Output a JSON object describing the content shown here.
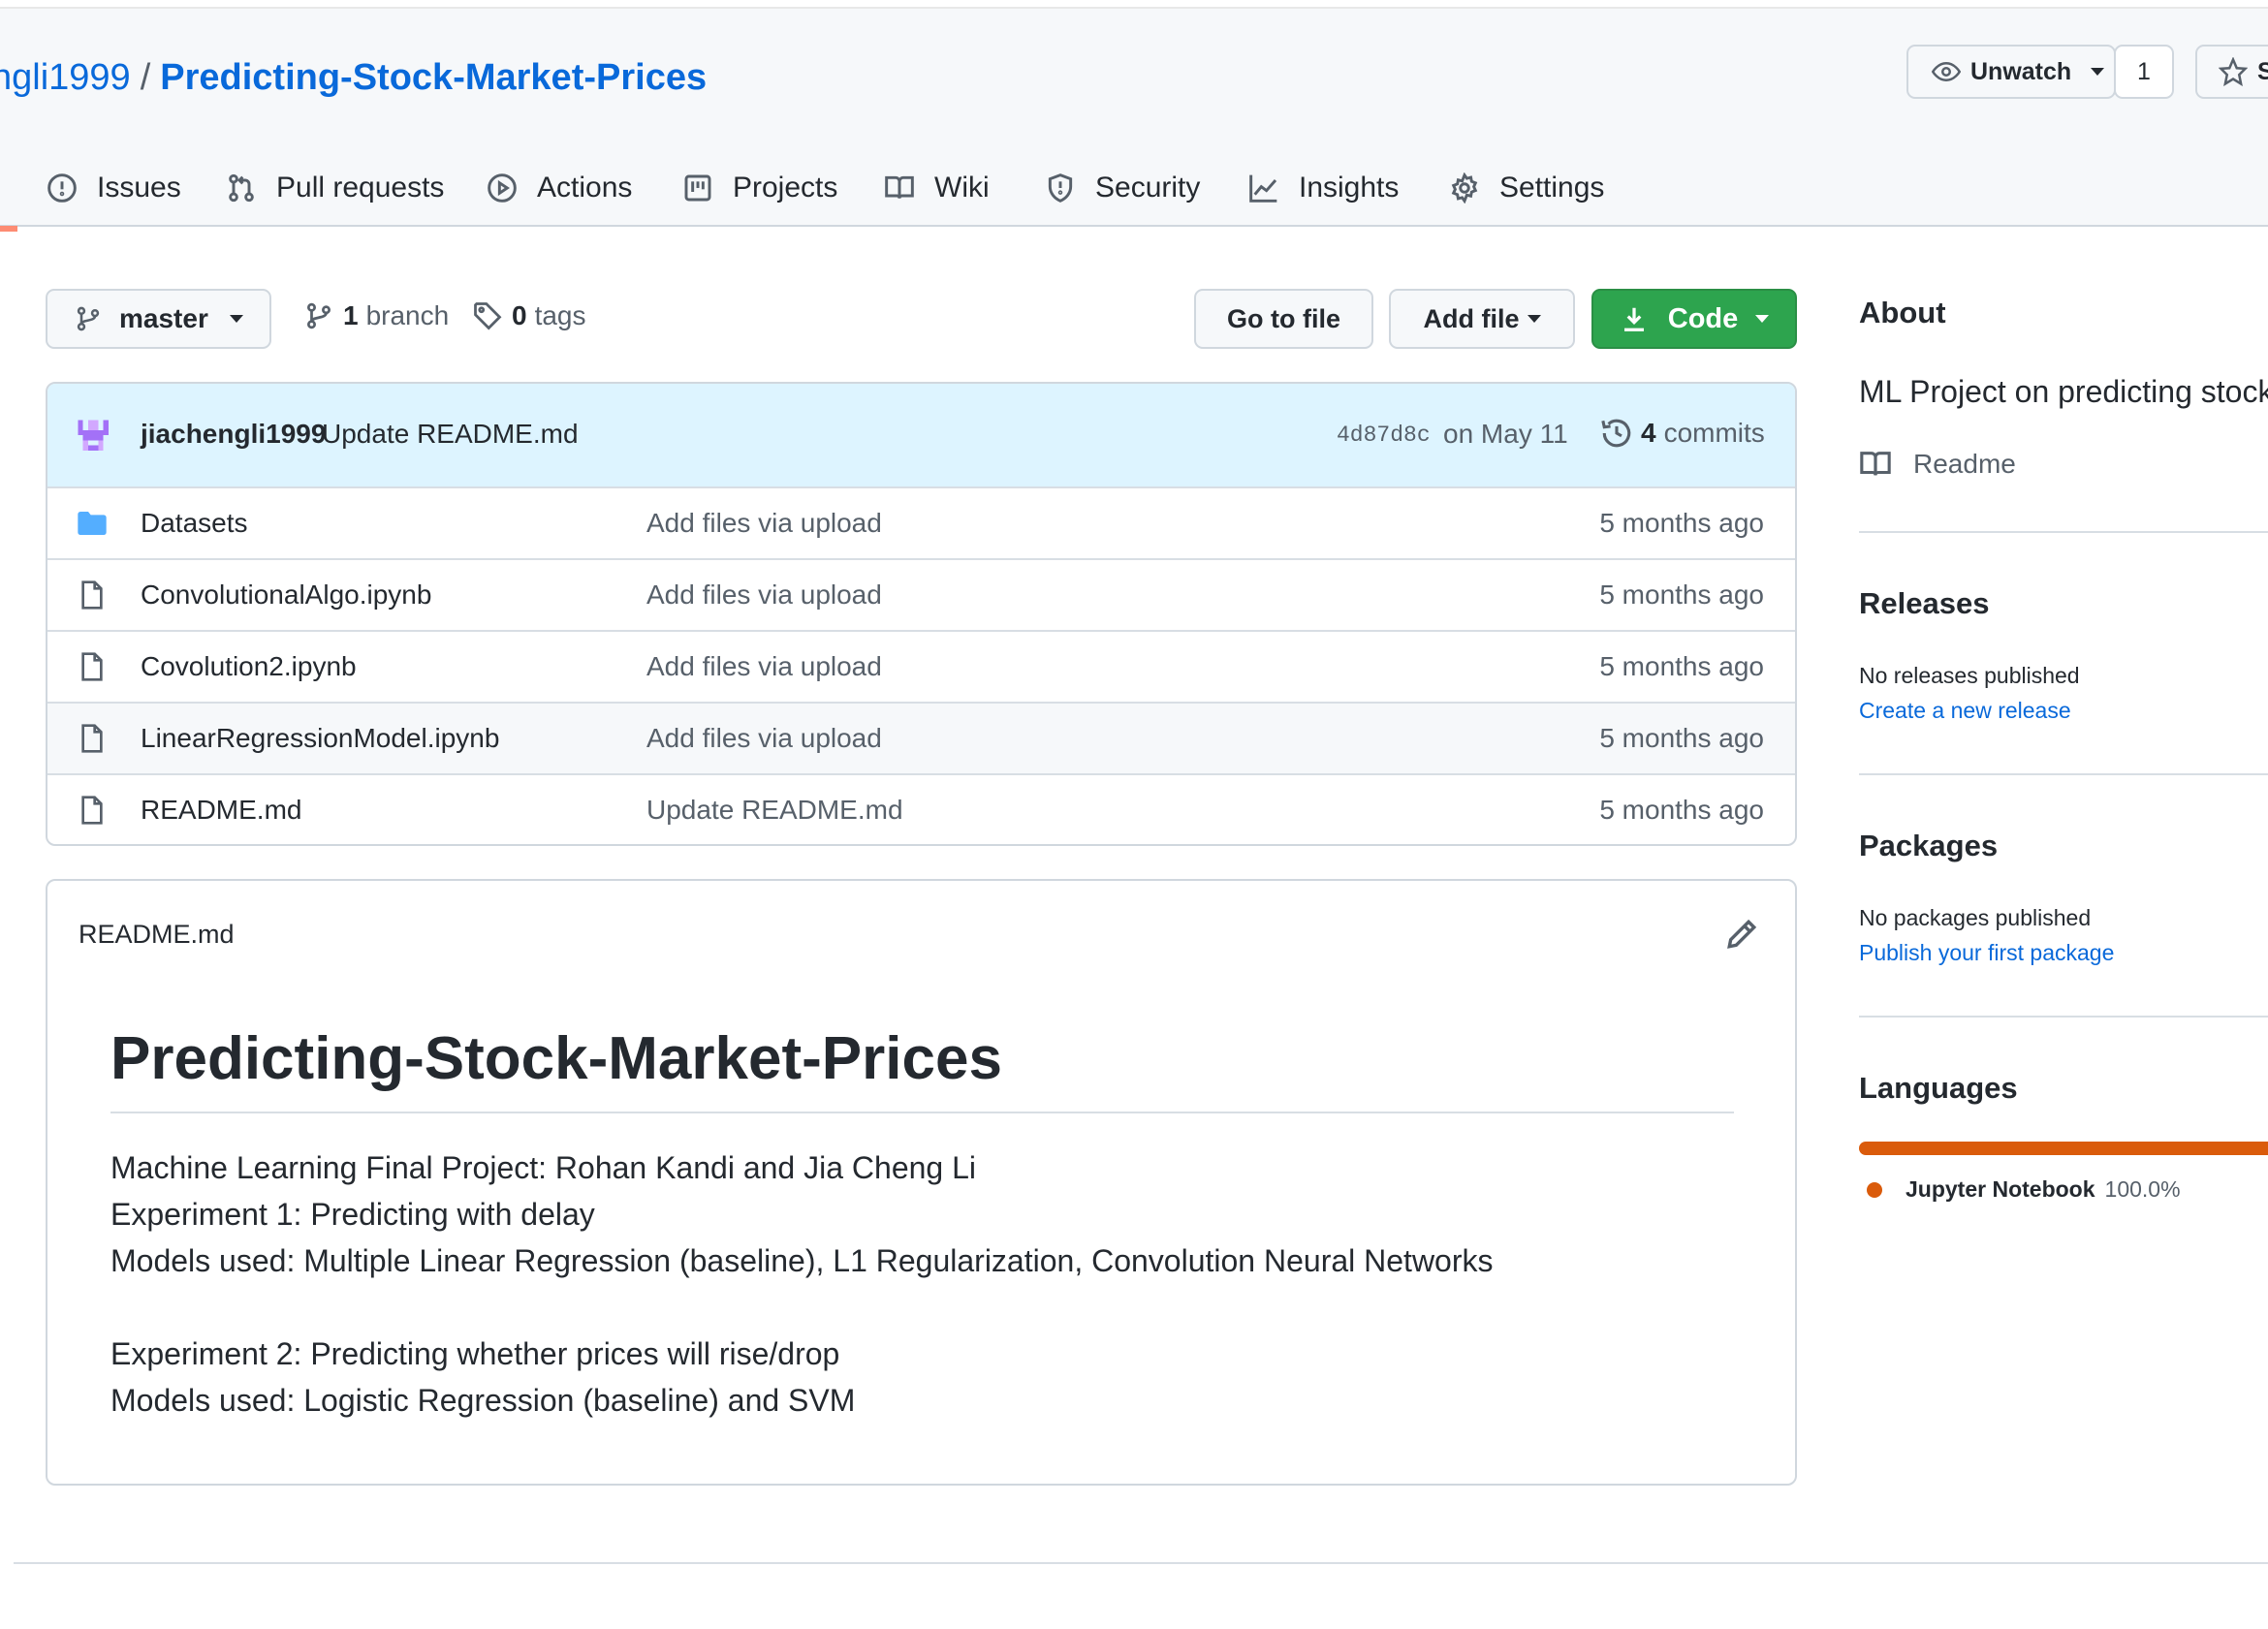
{
  "repo": {
    "owner": "ngli1999",
    "separator": "/",
    "name": "Predicting-Stock-Market-Prices"
  },
  "header_actions": {
    "unwatch_label": "Unwatch",
    "watch_count": "1",
    "star_label": "S"
  },
  "tabs": [
    {
      "label": "Issues",
      "icon": "issue-icon"
    },
    {
      "label": "Pull requests",
      "icon": "pull-request-icon"
    },
    {
      "label": "Actions",
      "icon": "play-icon"
    },
    {
      "label": "Projects",
      "icon": "project-icon"
    },
    {
      "label": "Wiki",
      "icon": "book-icon"
    },
    {
      "label": "Security",
      "icon": "shield-icon"
    },
    {
      "label": "Insights",
      "icon": "graph-icon"
    },
    {
      "label": "Settings",
      "icon": "gear-icon"
    }
  ],
  "toolbar": {
    "branch": "master",
    "branch_count": "1",
    "branch_label": "branch",
    "tag_count": "0",
    "tag_label": "tags",
    "go_to_file": "Go to file",
    "add_file": "Add file",
    "code": "Code"
  },
  "latest_commit": {
    "user": "jiachengli1999",
    "message": "Update README.md",
    "sha": "4d87d8c",
    "date": "on May 11",
    "commit_count": "4",
    "commit_label": "commits"
  },
  "files": [
    {
      "name": "Datasets",
      "type": "folder",
      "message": "Add files via upload",
      "age": "5 months ago"
    },
    {
      "name": "ConvolutionalAlgo.ipynb",
      "type": "file",
      "message": "Add files via upload",
      "age": "5 months ago"
    },
    {
      "name": "Covolution2.ipynb",
      "type": "file",
      "message": "Add files via upload",
      "age": "5 months ago"
    },
    {
      "name": "LinearRegressionModel.ipynb",
      "type": "file",
      "message": "Add files via upload",
      "age": "5 months ago"
    },
    {
      "name": "README.md",
      "type": "file",
      "message": "Update README.md",
      "age": "5 months ago"
    }
  ],
  "readme": {
    "filename": "README.md",
    "heading": "Predicting-Stock-Market-Prices",
    "lines": [
      "Machine Learning Final Project: Rohan Kandi and Jia Cheng Li",
      "Experiment 1: Predicting with delay",
      "Models used: Multiple Linear Regression (baseline), L1 Regularization, Convolution Neural Networks",
      "",
      "Experiment 2: Predicting whether prices will rise/drop",
      "Models used: Logistic Regression (baseline) and SVM"
    ]
  },
  "sidebar": {
    "about_title": "About",
    "description": "ML Project on predicting stock",
    "readme_link": "Readme",
    "releases_title": "Releases",
    "releases_text": "No releases published",
    "releases_link": "Create a new release",
    "packages_title": "Packages",
    "packages_text": "No packages published",
    "packages_link": "Publish your first package",
    "languages_title": "Languages",
    "language_name": "Jupyter Notebook",
    "language_pct": "100.0%",
    "language_share": 1.0,
    "language_color": "#da5b0b"
  },
  "colors": {
    "link": "#0969da",
    "primary_button": "#2da44e",
    "commit_bar": "#ddf4ff",
    "tab_underline": "#fd8c73"
  }
}
